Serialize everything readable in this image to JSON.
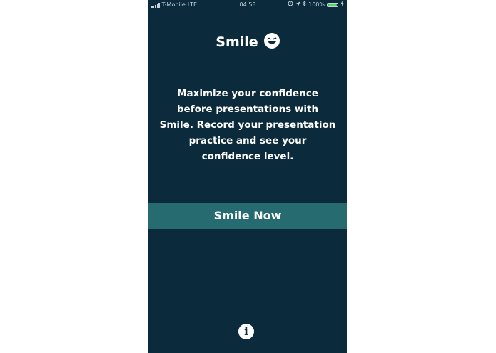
{
  "status_bar": {
    "carrier": "T-Mobile",
    "network": "LTE",
    "time": "04:58",
    "battery": "100%",
    "battery_level": 1.0
  },
  "app": {
    "title": "Smile",
    "description": "Maximize your confidence before presentations with Smile. Record your presentation practice and see your confidence level.",
    "primary_button": "Smile Now"
  },
  "icons": {
    "logo": "winking-smile-icon",
    "info": "info-icon"
  },
  "colors": {
    "background": "#0b2a3b",
    "button": "#266b6f",
    "text": "#ffffff",
    "battery": "#4cd964"
  }
}
